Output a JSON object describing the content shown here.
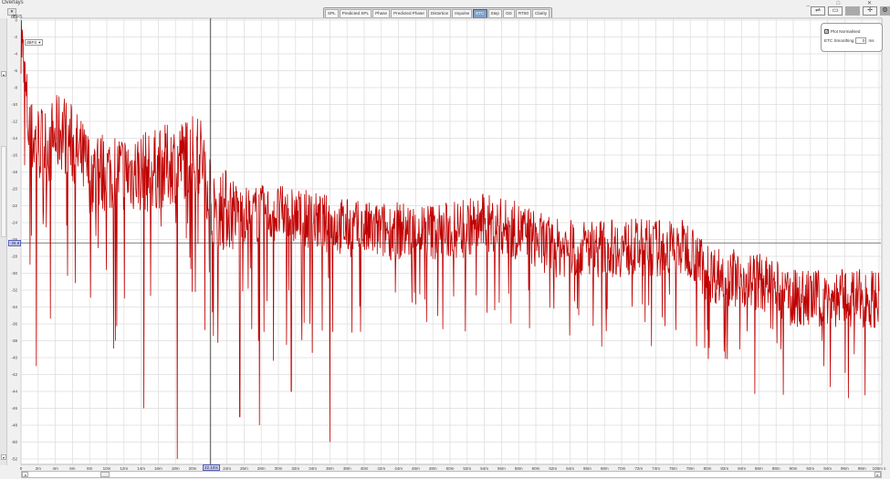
{
  "window": {
    "title": "Overlays",
    "controls": "_ □ ✕",
    "left_button": "▾"
  },
  "tabs": [
    {
      "label": "SPL"
    },
    {
      "label": "Predicted SPL"
    },
    {
      "label": "Phase"
    },
    {
      "label": "Predicted Phase"
    },
    {
      "label": "Distortion"
    },
    {
      "label": "Impulse"
    },
    {
      "label": "ETC",
      "active": true
    },
    {
      "label": "Step"
    },
    {
      "label": "GD"
    },
    {
      "label": "RT60"
    },
    {
      "label": "Clarity"
    }
  ],
  "toolbar_icons": [
    "trace-arrange-icon",
    "controls-panel-icon",
    "blank-panel-icon",
    "cursor-crosshair-icon",
    "settings-gear-icon"
  ],
  "controls": {
    "plot_normalised_label": "Plot Normalised",
    "plot_normalised_checked": true,
    "smoothing_label": "ETC Smoothing",
    "smoothing_value": "0",
    "smoothing_unit": "ms"
  },
  "unit_selector": {
    "value": "dBFS"
  },
  "cursor": {
    "x_label": "22.1ms",
    "y_label": "-25.6",
    "x_ms": 22.1,
    "y_db": -26.4
  },
  "colors": {
    "trace": "#c00000",
    "grid": "#d8d8d8",
    "cursor": "#333333"
  },
  "chart_data": {
    "type": "line",
    "title": "ETC",
    "ylabel": "dBFS",
    "xlabel": "ms",
    "xlim": [
      0,
      100
    ],
    "ylim": [
      -52,
      0
    ],
    "y_ticks": [
      0,
      -2,
      -4,
      -6,
      -8,
      -10,
      -12,
      -14,
      -16,
      -18,
      -20,
      -22,
      -24,
      -26,
      -28,
      -30,
      -32,
      -34,
      -36,
      -38,
      -40,
      -42,
      -44,
      -46,
      -48,
      -50,
      -52
    ],
    "x_ticks": [
      "0",
      "2m",
      "4m",
      "6m",
      "8m",
      "10m",
      "12m",
      "14m",
      "16m",
      "18m",
      "20m",
      "22m",
      "24m",
      "26m",
      "28m",
      "30m",
      "32m",
      "34m",
      "36m",
      "38m",
      "40m",
      "42m",
      "44m",
      "46m",
      "48m",
      "50m",
      "52m",
      "54m",
      "56m",
      "58m",
      "60m",
      "62m",
      "64m",
      "66m",
      "68m",
      "70m",
      "72m",
      "74m",
      "76m",
      "78m",
      "80m",
      "82m",
      "84m",
      "86m",
      "88m",
      "90m",
      "92m",
      "94m",
      "96m",
      "98m",
      "100m s"
    ],
    "series": [
      {
        "name": "ETC",
        "envelope_ms": [
          0,
          0.3,
          1,
          3,
          4.8,
          8,
          10,
          15,
          20,
          21,
          22.5,
          26,
          30,
          35,
          40,
          45,
          50,
          54,
          58,
          62,
          70,
          76,
          78,
          80,
          86,
          90,
          95,
          100
        ],
        "envelope_db": [
          -1,
          -6,
          -14,
          -15,
          -13,
          -18,
          -18,
          -18,
          -16,
          -16,
          -22,
          -23,
          -23,
          -24,
          -25,
          -25,
          -25,
          -24,
          -25,
          -27,
          -27,
          -27,
          -27,
          -30,
          -31,
          -33,
          -33,
          -33
        ],
        "dips": [
          [
            18.2,
            -52
          ],
          [
            36,
            -50
          ],
          [
            14.3,
            -46
          ],
          [
            11,
            -38
          ],
          [
            1.8,
            -41
          ],
          [
            25.5,
            -47
          ],
          [
            31.5,
            -44
          ],
          [
            27.8,
            -48
          ],
          [
            88.6,
            -39
          ],
          [
            82,
            -37
          ]
        ]
      }
    ]
  }
}
